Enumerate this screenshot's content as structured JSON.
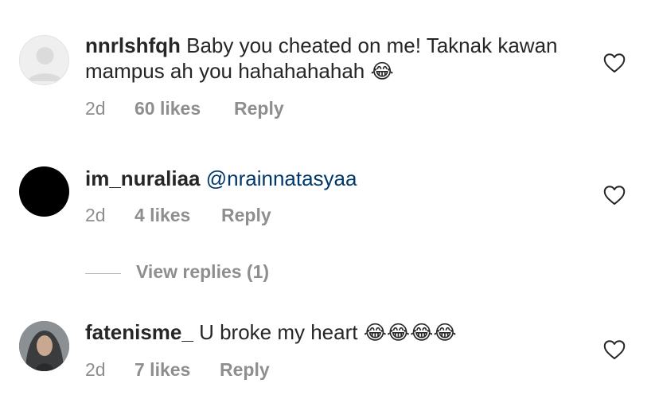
{
  "comments": [
    {
      "username": "nnrlshfqh",
      "text": "Baby you cheated on me! Taknak kawan mampus ah you hahahahahah",
      "emoji": "😂",
      "time": "2d",
      "likes": "60 likes",
      "reply": "Reply",
      "avatar": "default-avatar-icon"
    },
    {
      "username": "im_nuraliaa",
      "mention": "@nrainnatasyaa",
      "time": "2d",
      "likes": "4 likes",
      "reply": "Reply",
      "avatar": "black-avatar"
    },
    {
      "username": "fatenisme_",
      "text": "U broke my heart",
      "emoji": "😂😂😂😂",
      "time": "2d",
      "likes": "7 likes",
      "reply": "Reply",
      "avatar": "photo-avatar"
    }
  ],
  "view_replies": "View replies (1)",
  "colors": {
    "text": "#262626",
    "secondary": "#8e8e8e",
    "mention": "#00376b"
  }
}
